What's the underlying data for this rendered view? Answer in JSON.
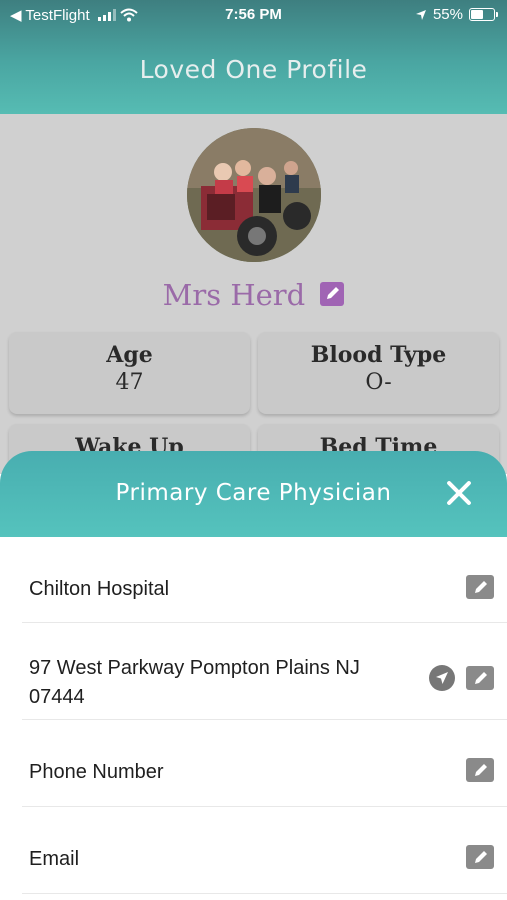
{
  "status_bar": {
    "back_app": "◀ TestFlight",
    "time": "7:56 PM",
    "battery": "55%"
  },
  "header": {
    "title": "Loved One Profile"
  },
  "profile": {
    "name": "Mrs Herd",
    "stats": [
      {
        "label": "Age",
        "value": "47"
      },
      {
        "label": "Blood Type",
        "value": "O-"
      },
      {
        "label": "Wake Up",
        "value": ""
      },
      {
        "label": "Bed Time",
        "value": ""
      }
    ]
  },
  "modal": {
    "title": "Primary Care Physician",
    "rows": [
      {
        "text": "Chilton Hospital"
      },
      {
        "text": "97 West Parkway Pompton Plains NJ 07444"
      },
      {
        "text": "Phone Number"
      },
      {
        "text": "Email"
      }
    ]
  },
  "icons": {
    "edit": "edit-icon",
    "navigate": "navigation-arrow-icon",
    "close": "close-icon",
    "wifi": "wifi-icon",
    "location": "location-arrow-icon",
    "battery": "battery-icon"
  },
  "colors": {
    "header_teal": "#4aa6a2",
    "accent_purple": "#9a6aa8",
    "sheet_teal": "#55c3bd"
  }
}
